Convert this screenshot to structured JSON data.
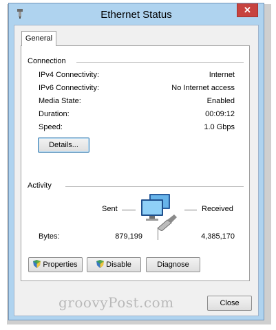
{
  "window": {
    "title": "Ethernet Status",
    "close_glyph": "✕",
    "tabs": [
      {
        "label": "General"
      }
    ]
  },
  "connection": {
    "heading": "Connection",
    "rows": [
      {
        "label": "IPv4 Connectivity:",
        "value": "Internet"
      },
      {
        "label": "IPv6 Connectivity:",
        "value": "No Internet access"
      },
      {
        "label": "Media State:",
        "value": "Enabled"
      },
      {
        "label": "Duration:",
        "value": "00:09:12"
      },
      {
        "label": "Speed:",
        "value": "1.0 Gbps"
      }
    ],
    "details_button": "Details..."
  },
  "activity": {
    "heading": "Activity",
    "sent_label": "Sent",
    "received_label": "Received",
    "bytes_label": "Bytes:",
    "bytes_sent": "879,199",
    "bytes_received": "4,385,170",
    "network_icon": "network-computers-icon"
  },
  "buttons": {
    "properties": "Properties",
    "disable": "Disable",
    "diagnose": "Diagnose",
    "close": "Close"
  },
  "watermark": "groovyPost.com",
  "colors": {
    "frame": "#afd3ef",
    "close_button": "#c7433f",
    "dialog_face": "#f0f0f0"
  }
}
